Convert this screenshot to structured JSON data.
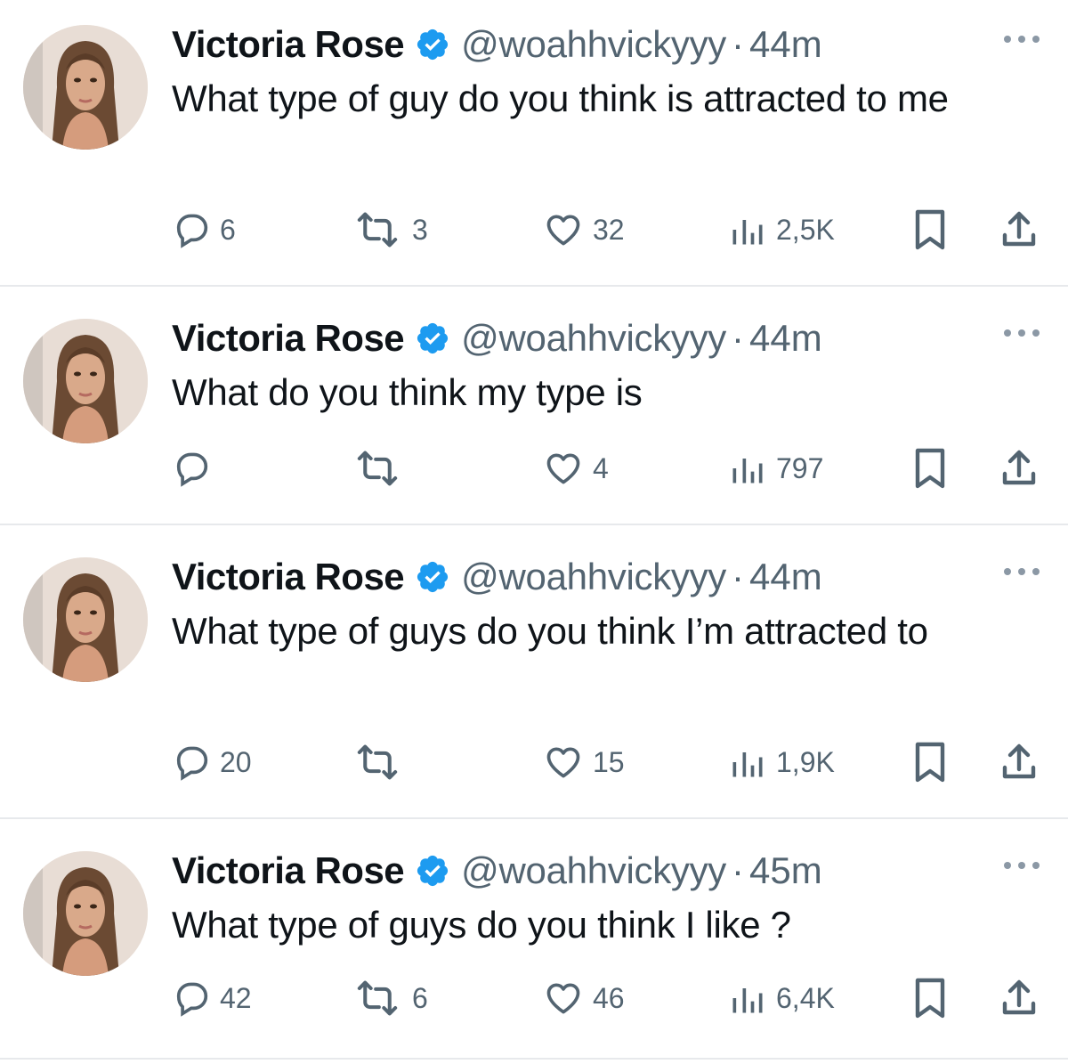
{
  "tweets": [
    {
      "name": "Victoria Rose",
      "handle": "@woahhvickyyy",
      "separator": "·",
      "time": "44m",
      "text": "What type of guy do you think is attracted to me",
      "replies": "6",
      "retweets": "3",
      "likes": "32",
      "views": "2,5K"
    },
    {
      "name": "Victoria Rose",
      "handle": "@woahhvickyyy",
      "separator": "·",
      "time": "44m",
      "text": "What do you think my type is",
      "replies": "",
      "retweets": "",
      "likes": "4",
      "views": "797"
    },
    {
      "name": "Victoria Rose",
      "handle": "@woahhvickyyy",
      "separator": "·",
      "time": "44m",
      "text": "What type of guys do you think I’m attracted to",
      "replies": "20",
      "retweets": "",
      "likes": "15",
      "views": "1,9K"
    },
    {
      "name": "Victoria Rose",
      "handle": "@woahhvickyyy",
      "separator": "·",
      "time": "45m",
      "text": "What type of guys do you think I like ?",
      "replies": "42",
      "retweets": "6",
      "likes": "46",
      "views": "6,4K"
    }
  ],
  "icons": {
    "verified": "verified-badge-icon",
    "more": "more-options-icon",
    "reply": "reply-icon",
    "retweet": "retweet-icon",
    "like": "heart-icon",
    "views": "views-icon",
    "bookmark": "bookmark-icon",
    "share": "share-icon"
  },
  "colors": {
    "verified": "#1d9bf0",
    "secondary_text": "#536471",
    "primary_text": "#0f1419",
    "divider": "#e7e9ec"
  }
}
